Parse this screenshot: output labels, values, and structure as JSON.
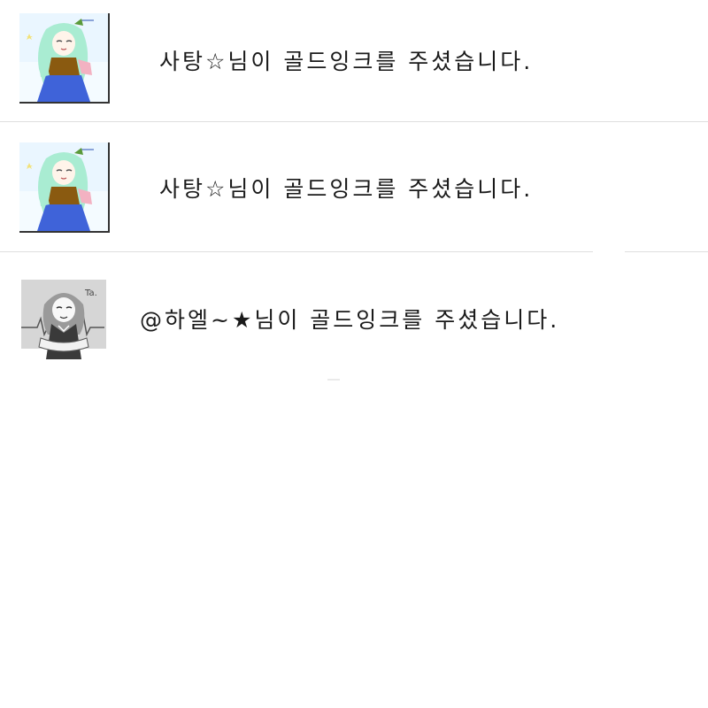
{
  "notifications": [
    {
      "user": "사탕☆",
      "message": "사탕☆님이 골드잉크를 주셨습니다.",
      "avatar": "green-haired-girl-avatar"
    },
    {
      "user": "사탕☆",
      "message": "사탕☆님이 골드잉크를 주셨습니다.",
      "avatar": "green-haired-girl-avatar"
    },
    {
      "user": "@하엘~★",
      "message": "@하엘~★님이 골드잉크를 주셨습니다.",
      "avatar": "grey-haired-girl-avatar"
    }
  ]
}
